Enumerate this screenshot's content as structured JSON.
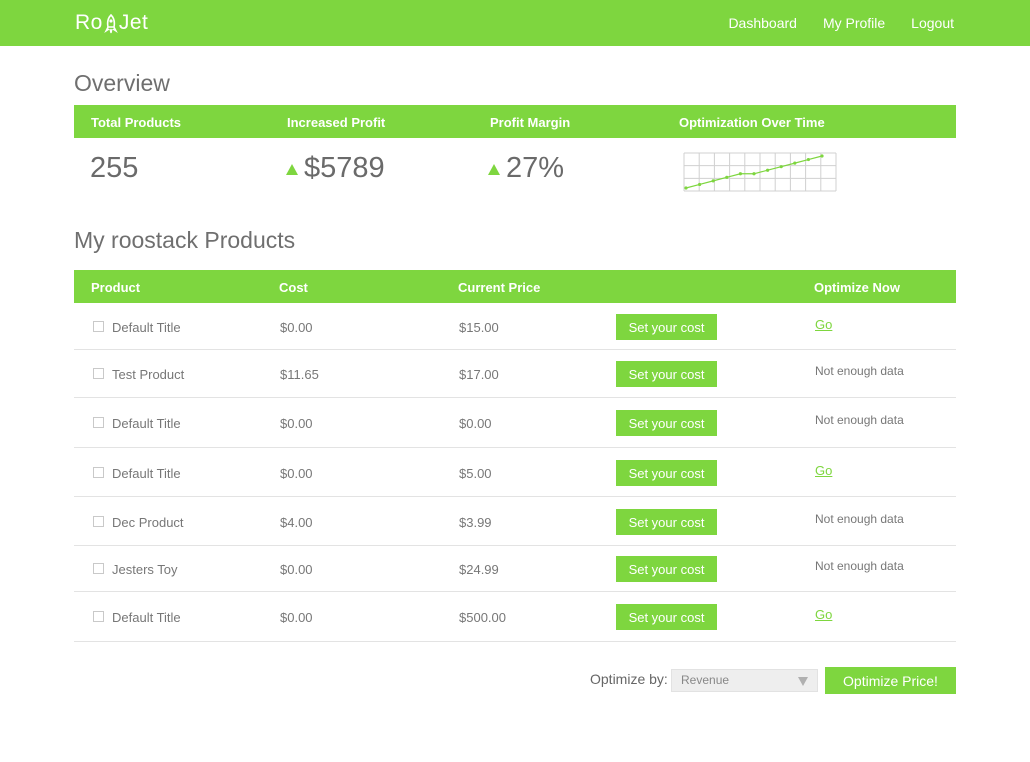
{
  "app": {
    "logo": {
      "left": "Ro",
      "right": "Jet"
    },
    "brand_color": "#7ed63f"
  },
  "nav": {
    "items": [
      "Dashboard",
      "My Profile",
      "Logout"
    ]
  },
  "overview": {
    "title": "Overview",
    "headers": [
      "Total Products",
      "Increased Profit",
      "Profit Margin",
      "Optimization Over Time"
    ],
    "total_products": "255",
    "increased_profit": "$5789",
    "profit_margin": "27%",
    "trend_icon": "up-triangle-icon",
    "sparkline": [
      0,
      1,
      2,
      3,
      4,
      4,
      5,
      6,
      7,
      8,
      9
    ]
  },
  "products": {
    "title": "My roostack Products",
    "headers": [
      "Product",
      "Cost",
      "Current Price",
      "Optimize Now"
    ],
    "button_label": "Set your cost",
    "rows": [
      {
        "name": "Default Title",
        "cost": "$0.00",
        "price": "$15.00",
        "optimize": "Go"
      },
      {
        "name": "Test Product",
        "cost": "$11.65",
        "price": "$17.00",
        "optimize": "Not enough data"
      },
      {
        "name": "Default Title",
        "cost": "$0.00",
        "price": "$0.00",
        "optimize": "Not enough data"
      },
      {
        "name": "Default Title",
        "cost": "$0.00",
        "price": "$5.00",
        "optimize": "Go"
      },
      {
        "name": "Dec Product",
        "cost": "$4.00",
        "price": "$3.99",
        "optimize": "Not enough data"
      },
      {
        "name": "Jesters Toy",
        "cost": "$0.00",
        "price": "$24.99",
        "optimize": "Not enough data"
      },
      {
        "name": "Default Title",
        "cost": "$0.00",
        "price": "$500.00",
        "optimize": "Go"
      }
    ]
  },
  "footer": {
    "optimize_by_label": "Optimize by:",
    "optimize_by_value": "Revenue",
    "optimize_button": "Optimize Price!"
  }
}
